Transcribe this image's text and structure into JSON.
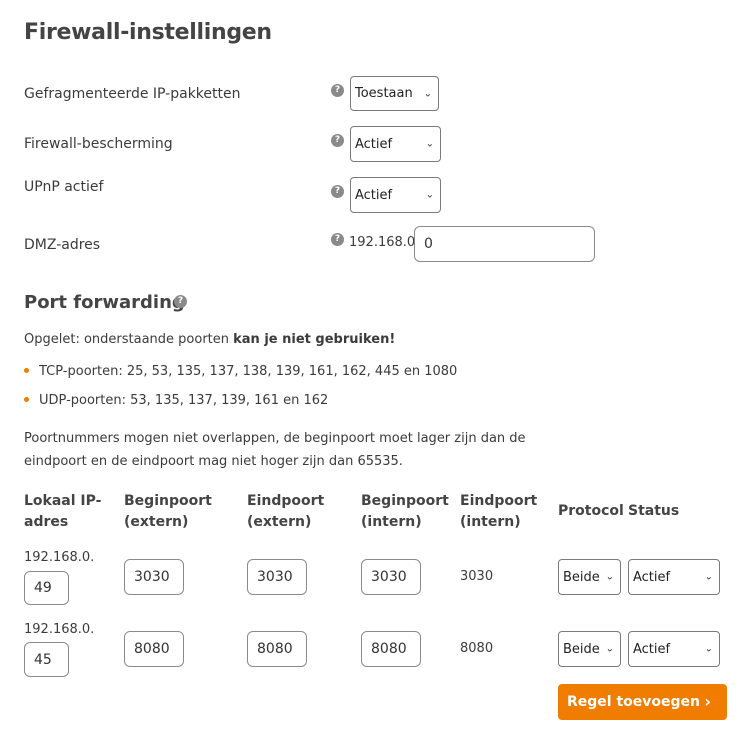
{
  "page_title": "Firewall-instellingen",
  "settings": {
    "fragmented": {
      "label": "Gefragmenteerde IP-pakketten",
      "value": "Toestaan"
    },
    "firewall": {
      "label": "Firewall-bescherming",
      "value": "Actief"
    },
    "upnp": {
      "label": "UPnP actief",
      "value": "Actief"
    },
    "dmz": {
      "label": "DMZ-adres",
      "prefix": "192.168.0.",
      "value": "0"
    }
  },
  "help_glyph": "?",
  "port_forwarding": {
    "title": "Port forwarding",
    "warning_prefix": "Opgelet: onderstaande poorten ",
    "warning_bold": "kan je niet gebruiken!",
    "bullets": [
      "TCP-poorten: 25, 53, 135, 137, 138, 139, 161, 162, 445 en 1080",
      "UDP-poorten: 53, 135, 137, 139, 161 en 162"
    ],
    "note_line1": "Poortnummers mogen niet overlappen, de beginpoort moet lager zijn dan de",
    "note_line2": "eindpoort en de eindpoort mag niet hoger zijn dan 65535.",
    "headers": {
      "local_ip_1": "Lokaal IP-",
      "local_ip_2": "adres",
      "begin_ext_1": "Beginpoort",
      "begin_ext_2": "(extern)",
      "end_ext_1": "Eindpoort",
      "end_ext_2": "(extern)",
      "begin_int_1": "Beginpoort",
      "begin_int_2": "(intern)",
      "end_int_1": "Eindpoort",
      "end_int_2": "(intern)",
      "protocol": "Protocol",
      "status": "Status"
    },
    "rows": [
      {
        "ip_prefix": "192.168.0.",
        "ip_suffix": "49",
        "begin_ext": "3030",
        "end_ext": "3030",
        "begin_int": "3030",
        "end_int": "3030",
        "protocol": "Beide",
        "status": "Actief"
      },
      {
        "ip_prefix": "192.168.0.",
        "ip_suffix": "45",
        "begin_ext": "8080",
        "end_ext": "8080",
        "begin_int": "8080",
        "end_int": "8080",
        "protocol": "Beide",
        "status": "Actief"
      }
    ],
    "add_button": "Regel toevoegen"
  },
  "colors": {
    "accent": "#f07d00",
    "help_icon": "#8a8a8a"
  },
  "icons": {
    "help": "question-circle-icon",
    "dropdown": "chevron-down-icon",
    "button": "chevron-right-icon"
  }
}
